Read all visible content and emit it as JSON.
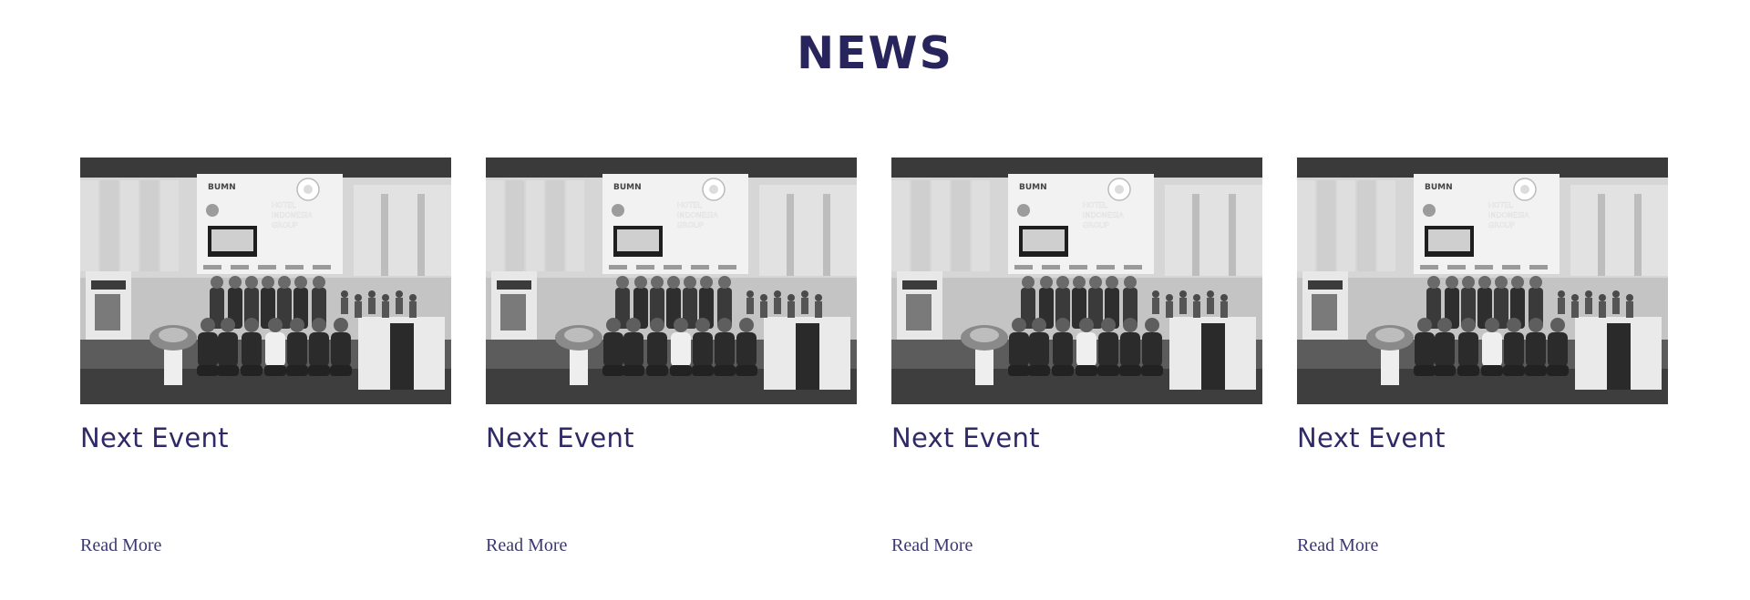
{
  "section": {
    "title": "NEWS"
  },
  "cards": [
    {
      "title": "Next Event",
      "link_label": "Read More",
      "image_alt": "Group photo at exhibition booth"
    },
    {
      "title": "Next Event",
      "link_label": "Read More",
      "image_alt": "Group photo at exhibition booth"
    },
    {
      "title": "Next Event",
      "link_label": "Read More",
      "image_alt": "Group photo at exhibition booth"
    },
    {
      "title": "Next Event",
      "link_label": "Read More",
      "image_alt": "Group photo at exhibition booth"
    }
  ],
  "booth_sign": {
    "line1": "BUMN",
    "line2": "HOTEL",
    "line3": "INDONESIA",
    "line4": "GROUP"
  },
  "colors": {
    "heading": "#28245c",
    "card_title": "#2f2a66",
    "link": "#3c3870",
    "background": "#ffffff"
  }
}
